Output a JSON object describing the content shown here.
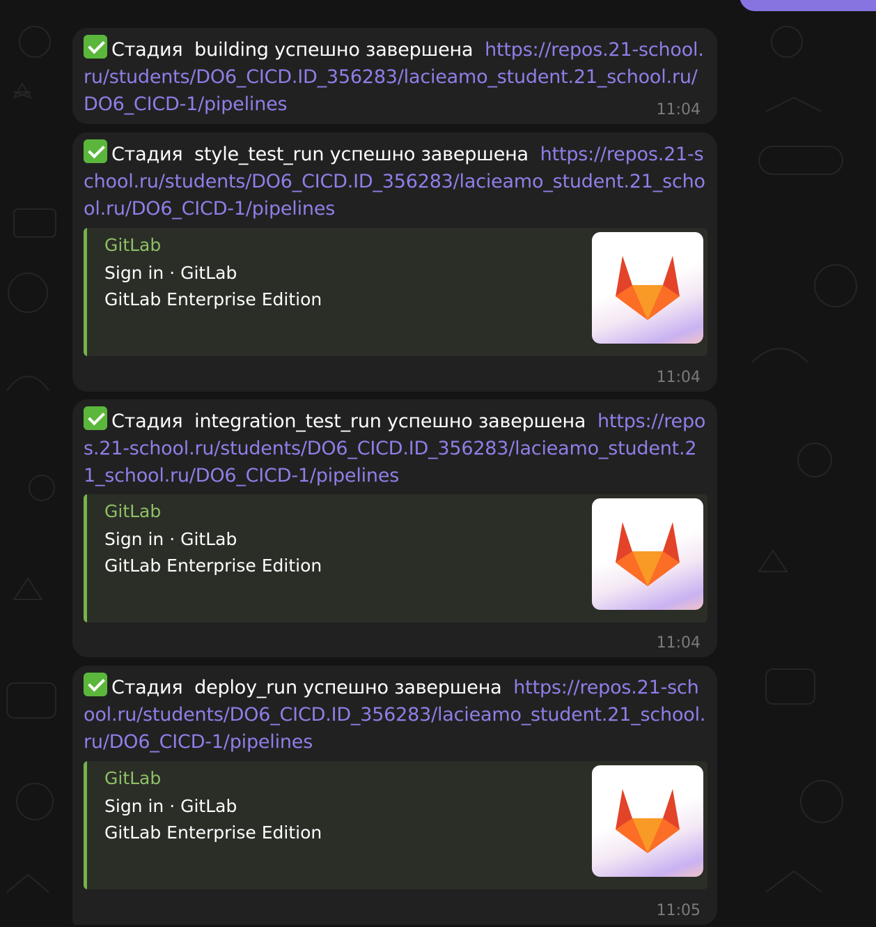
{
  "messages": [
    {
      "stage_prefix": "Стадия",
      "stage": "building",
      "stage_suffix": "успешно завершена",
      "link": "https://repos.21-school.ru/students/DO6_CICD.ID_356283/lacieamo_student.21_school.ru/DO6_CICD-1/pipelines",
      "time": "11:04"
    },
    {
      "stage_prefix": "Стадия",
      "stage": "style_test_run",
      "stage_suffix": "успешно завершена",
      "link": "https://repos.21-school.ru/students/DO6_CICD.ID_356283/lacieamo_student.21_school.ru/DO6_CICD-1/pipelines",
      "preview": {
        "site": "GitLab",
        "title": "Sign in · GitLab",
        "description": "GitLab Enterprise Edition",
        "thumbnail_icon": "gitlab-logo-icon"
      },
      "time": "11:04"
    },
    {
      "stage_prefix": "Стадия",
      "stage": "integration_test_run",
      "stage_suffix": "успешно завершена",
      "link": "https://repos.21-school.ru/students/DO6_CICD.ID_356283/lacieamo_student.21_school.ru/DO6_CICD-1/pipelines",
      "preview": {
        "site": "GitLab",
        "title": "Sign in · GitLab",
        "description": "GitLab Enterprise Edition",
        "thumbnail_icon": "gitlab-logo-icon"
      },
      "time": "11:04"
    },
    {
      "stage_prefix": "Стадия",
      "stage": "deploy_run",
      "stage_suffix": "успешно завершена",
      "link": "https://repos.21-school.ru/students/DO6_CICD.ID_356283/lacieamo_student.21_school.ru/DO6_CICD-1/pipelines",
      "preview": {
        "site": "GitLab",
        "title": "Sign in · GitLab",
        "description": "GitLab Enterprise Edition",
        "thumbnail_icon": "gitlab-logo-icon"
      },
      "time": "11:05"
    }
  ],
  "colors": {
    "background": "#141414",
    "bubble": "#212121",
    "link": "#8f7fe8",
    "preview_bg": "#2a2e27",
    "preview_accent": "#78b34a",
    "outgoing_bubble": "#8774e1"
  },
  "icons": {
    "status": "check-mark-button-icon"
  }
}
